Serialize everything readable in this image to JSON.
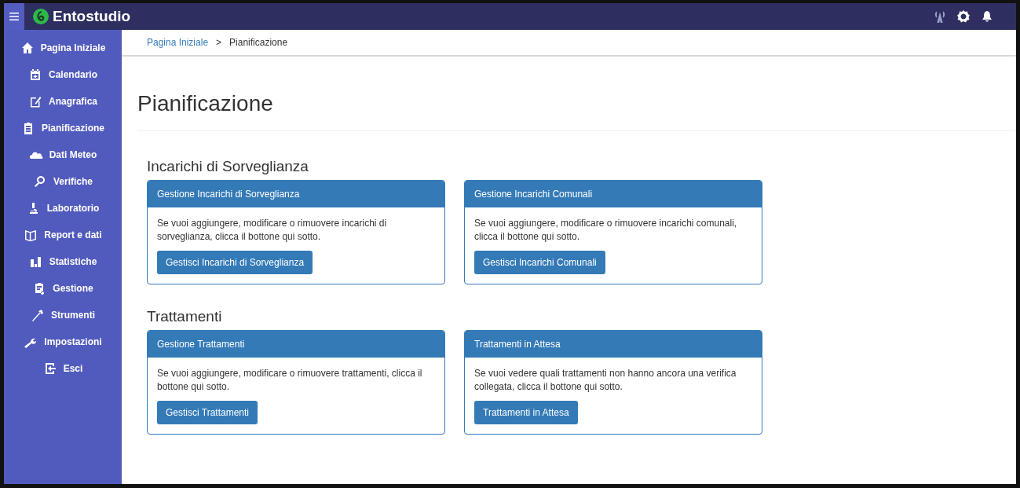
{
  "app": {
    "title": "Entostudio"
  },
  "sidebar": {
    "items": [
      {
        "label": "Pagina Iniziale"
      },
      {
        "label": "Calendario"
      },
      {
        "label": "Anagrafica"
      },
      {
        "label": "Pianificazione"
      },
      {
        "label": "Dati Meteo"
      },
      {
        "label": "Verifiche"
      },
      {
        "label": "Laboratorio"
      },
      {
        "label": "Report e dati"
      },
      {
        "label": "Statistiche"
      },
      {
        "label": "Gestione"
      },
      {
        "label": "Strumenti"
      },
      {
        "label": "Impostazioni"
      },
      {
        "label": "Esci"
      }
    ]
  },
  "breadcrumb": {
    "link": "Pagina Iniziale",
    "separator": ">",
    "current": "Pianificazione"
  },
  "page_title": "Pianificazione",
  "sections": [
    {
      "heading": "Incarichi di Sorveglianza",
      "cards": [
        {
          "header": "Gestione Incarichi di Sorveglianza",
          "text": "Se vuoi aggiungere, modificare o rimuovere incarichi di sorveglianza, clicca il bottone qui sotto.",
          "button": "Gestisci Incarichi di Sorveglianza"
        },
        {
          "header": "Gestione Incarichi Comunali",
          "text": "Se vuoi aggiungere, modificare o rimuovere incarichi comunali, clicca il bottone qui sotto.",
          "button": "Gestisci Incarichi Comunali"
        }
      ]
    },
    {
      "heading": "Trattamenti",
      "cards": [
        {
          "header": "Gestione Trattamenti",
          "text": "Se vuoi aggiungere, modificare o rimuovere trattamenti, clicca il bottone qui sotto.",
          "button": "Gestisci Trattamenti"
        },
        {
          "header": "Trattamenti in Attesa",
          "text": "Se vuoi vedere quali trattamenti non hanno ancora una verifica collegata, clicca il bottone qui sotto.",
          "button": "Trattamenti in Attesa"
        }
      ]
    }
  ]
}
